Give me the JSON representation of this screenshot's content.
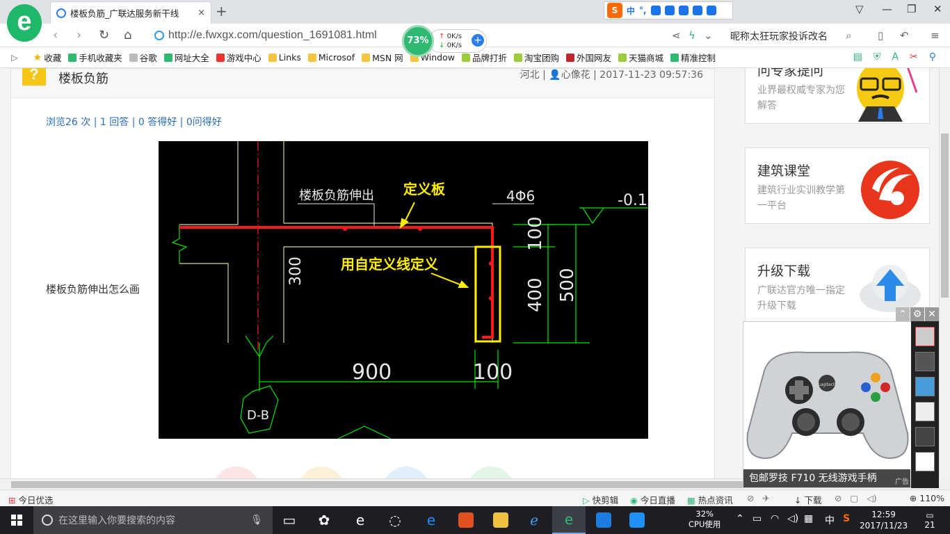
{
  "browser": {
    "logo_letter": "e",
    "tab_title": "楼板负筋_广联达服务新干线",
    "tab_close": "×",
    "new_tab": "+",
    "url": "http://e.fwxgx.com/question_1691081.html",
    "speed_percent": "73%",
    "speed_up": "0K/s",
    "speed_down": "0K/s",
    "search_hint": "昵称太狂玩家投诉改名",
    "ime_label": "中",
    "ime_punct": "°,"
  },
  "bookmarks": [
    {
      "label": "收藏",
      "type": "star"
    },
    {
      "label": "手机收藏夹",
      "type": "phone"
    },
    {
      "label": "谷歌",
      "type": "page"
    },
    {
      "label": "网址大全",
      "type": "globe"
    },
    {
      "label": "游戏中心",
      "type": "game"
    },
    {
      "label": "Links",
      "type": "folder"
    },
    {
      "label": "Microsof",
      "type": "folder"
    },
    {
      "label": "MSN 网",
      "type": "folder"
    },
    {
      "label": "Window",
      "type": "folder"
    },
    {
      "label": "品牌打折",
      "type": "leaf"
    },
    {
      "label": "淘宝团购",
      "type": "leaf"
    },
    {
      "label": "外国网友",
      "type": "flag"
    },
    {
      "label": "天猫商城",
      "type": "leaf"
    },
    {
      "label": "精准控制",
      "type": "chat"
    }
  ],
  "question": {
    "badge": "?",
    "title": "楼板负筋",
    "meta": "河北 | 👤心像花 | 2017-11-23 09:57:36",
    "stats": "浏览26 次 | 1 回答 | 0 答得好 | 0问得好",
    "body": "楼板负筋伸出怎么画"
  },
  "cad_drawing": {
    "label_rebar": "楼板负筋伸出",
    "label_define_slab": "定义板",
    "label_custom_line": "用自定义线定义",
    "label_bar": "4Φ6",
    "label_level": "-0.1",
    "dim_100_top": "100",
    "dim_400": "400",
    "dim_500": "500",
    "dim_300": "300",
    "dim_900": "900",
    "dim_100_bottom": "100",
    "axis_tag": "D-B",
    "colors": {
      "red": "#ff1a1a",
      "yellow": "#ffee00",
      "green": "#00e600",
      "white": "#e8e8e8"
    }
  },
  "sidebar": [
    {
      "title": "问专家提问",
      "sub": "业界最权威专家为您解答"
    },
    {
      "title": "建筑课堂",
      "sub": "建筑行业实训教学第一平台"
    },
    {
      "title": "升级下载",
      "sub": "广联达官方唯一指定升级下载"
    }
  ],
  "ad": {
    "caption": "包邮罗技 F710 无线游戏手柄",
    "tag": "广告",
    "brand": "Logitech"
  },
  "statusbar": {
    "left": "今日优选",
    "items": [
      "快剪辑",
      "今日直播",
      "热点资讯",
      "下载"
    ],
    "zoom": "110%"
  },
  "taskbar": {
    "search_placeholder": "在这里输入你要搜索的内容",
    "cpu_percent": "32%",
    "cpu_label": "CPU使用",
    "ime": "中",
    "time": "12:59",
    "date": "2017/11/23",
    "notifications": "21"
  }
}
